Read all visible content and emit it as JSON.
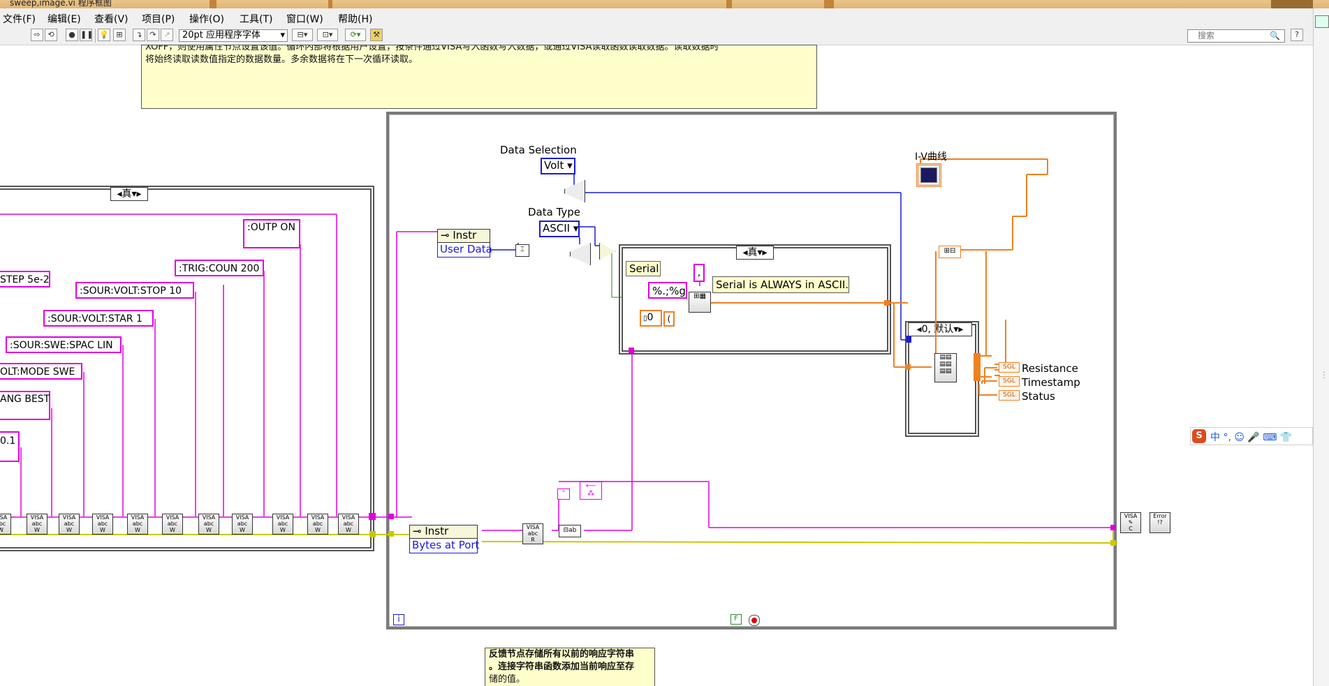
{
  "window": {
    "title_fragment": "sweep,image.vi 程序框图"
  },
  "menu": [
    {
      "label": "文件(F)"
    },
    {
      "label": "编辑(E)"
    },
    {
      "label": "查看(V)"
    },
    {
      "label": "项目(P)"
    },
    {
      "label": "操作(O)"
    },
    {
      "label": "工具(T)"
    },
    {
      "label": "窗口(W)"
    },
    {
      "label": "帮助(H)"
    }
  ],
  "toolbar": {
    "font": "20pt 应用程序字体",
    "search_placeholder": "搜索",
    "help": "?"
  },
  "comments": {
    "top_line1": "XOFF，则使用属性节点设置该值。循环内部将根据用户设置，按条件通过VISA写入函数写入数据，或通过VISA读取函数读取数据。读取数据时",
    "top_line2": "将始终读取读数值指定的数据数量。多余数据将在下一次循环读取。",
    "bottom_line1": "反馈节点存储所有以前的响应字符串",
    "bottom_line2": "。连接字符串函数添加当前响应至存",
    "bottom_line3": "储的值。"
  },
  "left_case": {
    "selector": "真"
  },
  "scpi_strings": [
    ":OUTP ON",
    ":TRIG:COUN 200",
    "STEP 5e-2",
    ":SOUR:VOLT:STOP 10",
    ":SOUR:VOLT:STAR 1",
    ":SOUR:SWE:SPAC LIN",
    "OLT:MODE SWE",
    "ANG BEST",
    "0.1"
  ],
  "visa_label": "VISA",
  "main": {
    "data_selection_label": "Data Selection",
    "data_selection_value": "Volt",
    "data_type_label": "Data Type",
    "data_type_value": "ASCII",
    "instr_node": "Instr",
    "user_data": "User Data",
    "bytes_at_port": "Bytes at Port",
    "iv_label": "I-V曲线",
    "loop_index": "i",
    "stop_const": "F"
  },
  "inner_case": {
    "selector": "真",
    "serial_label": "Serial",
    "comma_const": ",",
    "format_const": "%.;%g",
    "note": "Serial is ALWAYS in ASCII.",
    "zero_const": "0"
  },
  "right_case": {
    "selector": "0, 默认"
  },
  "outputs": [
    {
      "label": "Resistance"
    },
    {
      "label": "Timestamp"
    },
    {
      "label": "Status"
    }
  ],
  "sgl_tag": "SGL",
  "error_label": "Error",
  "ime": {
    "chars": "中 °, ☺ 🎤 ⌨ 👕"
  },
  "colors": {
    "string_wire": "#e000e0",
    "numeric_wire": "#f08020",
    "enum_wire": "#1a1ad8",
    "error_wire": "#c8c800",
    "note_bg": "#ffffcc"
  }
}
